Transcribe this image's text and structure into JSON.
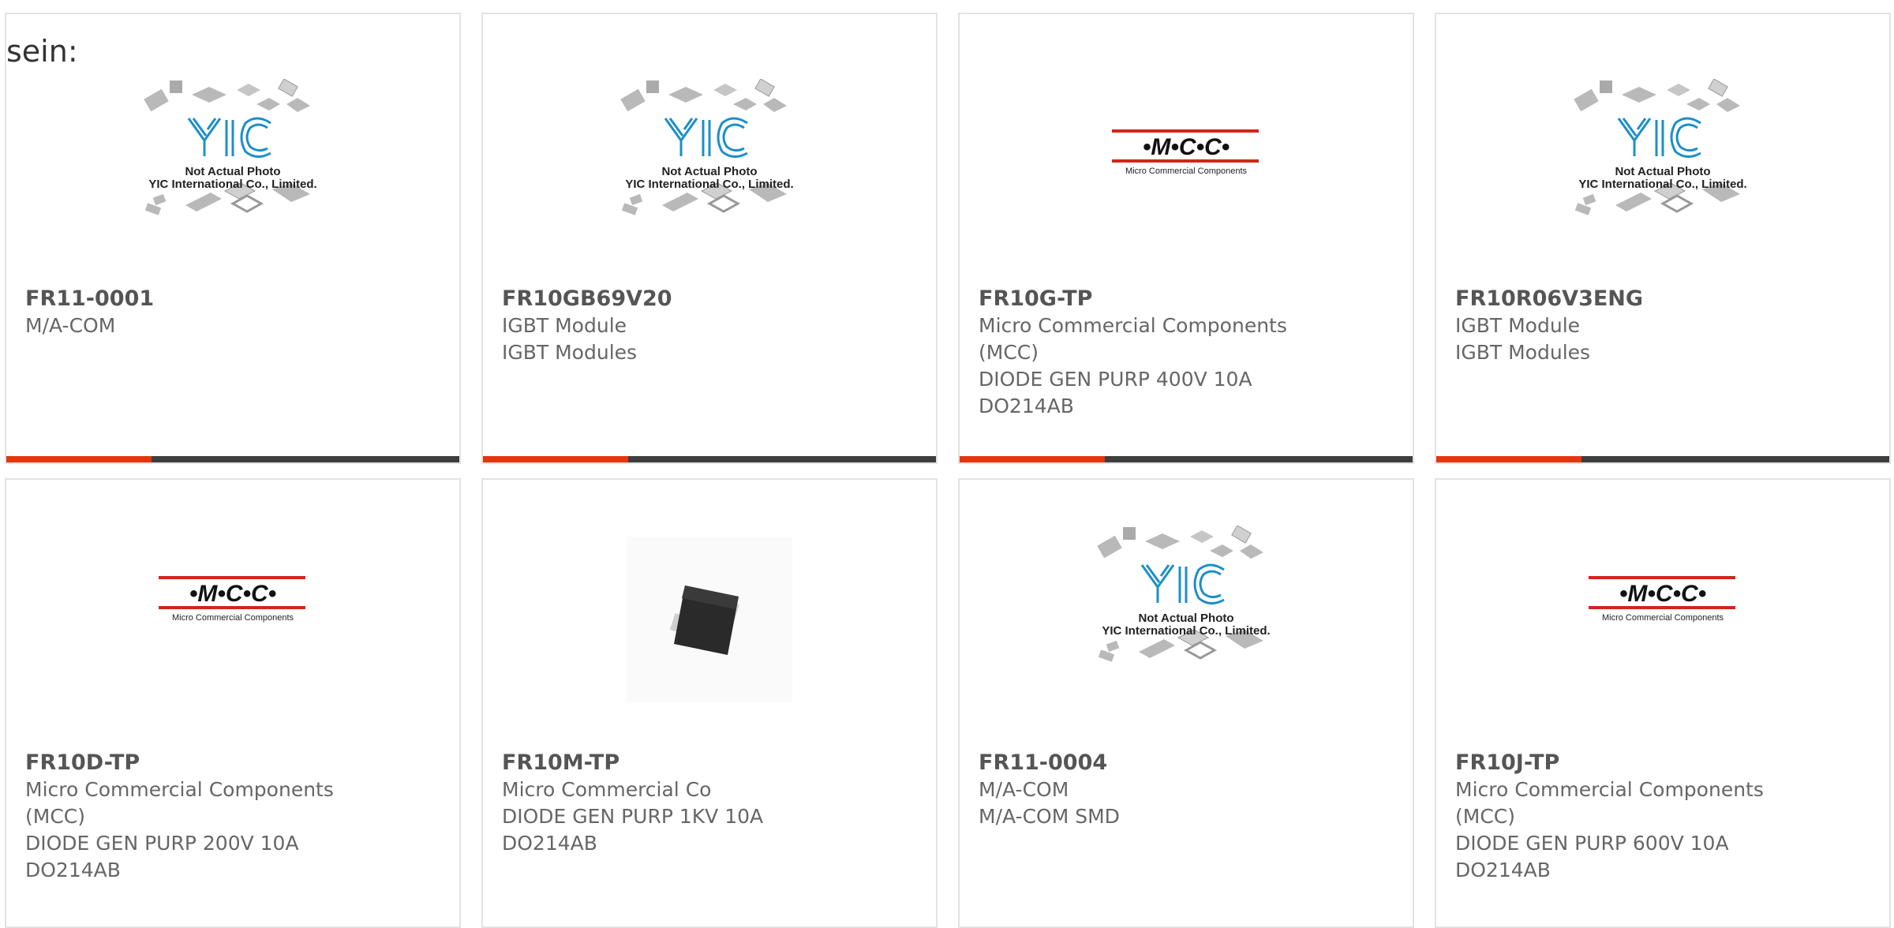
{
  "page_fragment": "sein:",
  "colors": {
    "accent": "#e2360f",
    "bar": "#3e3e3e",
    "mcc_red": "#d1261b",
    "yic_blue": "#1c8fc8"
  },
  "placeholders": {
    "yic": {
      "line1": "Not Actual Photo",
      "line2": "YIC International Co., Limited."
    },
    "mcc": {
      "logo": "•M•C•C•",
      "sub": "Micro Commercial Components"
    }
  },
  "products": [
    {
      "part": "FR11-0001",
      "lines": [
        "M/A-COM"
      ],
      "image": "yic-placeholder"
    },
    {
      "part": "FR10GB69V20",
      "lines": [
        "IGBT Module",
        "IGBT Modules"
      ],
      "image": "yic-placeholder"
    },
    {
      "part": "FR10G-TP",
      "lines": [
        "Micro Commercial Components (MCC)",
        "DIODE GEN PURP 400V 10A DO214AB"
      ],
      "image": "mcc-logo"
    },
    {
      "part": "FR10R06V3ENG",
      "lines": [
        "IGBT Module",
        "IGBT Modules"
      ],
      "image": "yic-placeholder"
    },
    {
      "part": "FR10D-TP",
      "lines": [
        "Micro Commercial Components (MCC)",
        "DIODE GEN PURP 200V 10A DO214AB"
      ],
      "image": "mcc-logo"
    },
    {
      "part": "FR10M-TP",
      "lines": [
        "Micro Commercial Co",
        "DIODE GEN PURP 1KV 10A DO214AB"
      ],
      "image": "diode-photo"
    },
    {
      "part": "FR11-0004",
      "lines": [
        "M/A-COM",
        "M/A-COM SMD"
      ],
      "image": "yic-placeholder"
    },
    {
      "part": "FR10J-TP",
      "lines": [
        "Micro Commercial Components (MCC)",
        "DIODE GEN PURP 600V 10A DO214AB"
      ],
      "image": "mcc-logo"
    }
  ]
}
